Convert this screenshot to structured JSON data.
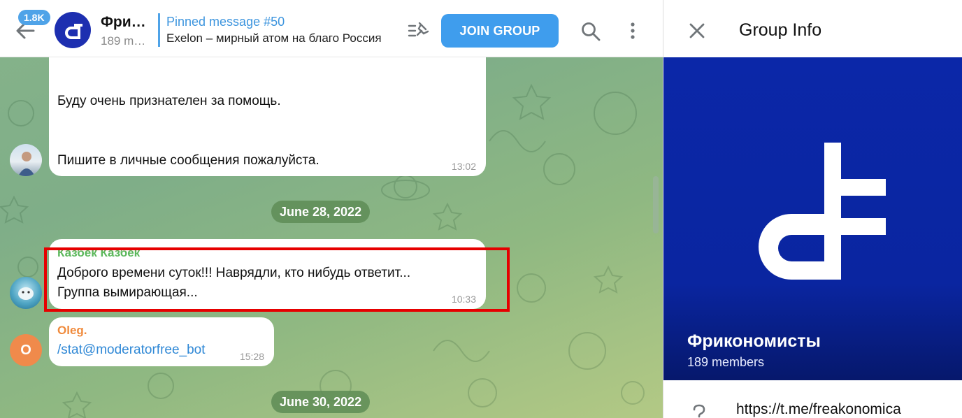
{
  "header": {
    "unread_count": "1.8K",
    "chat_title": "Фрикономисты",
    "chat_subtitle": "189 members",
    "pinned_title": "Pinned message #50",
    "pinned_text": "Exelon – мирный атом на благо Россия",
    "join_label": "JOIN GROUP"
  },
  "messages": [
    {
      "lines": [
        "Буду очень признателен за помощь.",
        "Пишите в личные сообщения пожалуйста."
      ],
      "time": "13:02"
    },
    {
      "sender": "Казбек Казбек",
      "lines": [
        "Доброго времени суток!!! Наврядли, кто нибудь ответит...",
        "Группа вымирающая..."
      ],
      "time": "10:33"
    },
    {
      "sender": "Oleg.",
      "avatar_letter": "O",
      "lines": [
        "/stat@moderatorfree_bot"
      ],
      "time": "15:28"
    }
  ],
  "dates": [
    "June 28, 2022",
    "June 30, 2022"
  ],
  "info_panel": {
    "title": "Group Info",
    "group_name": "Фрикономисты",
    "members": "189 members",
    "link": "https://t.me/freakonomica"
  },
  "colors": {
    "accent": "#3f9ded",
    "cover_blue": "#0b27a8",
    "highlight": "#e60000",
    "sender_green": "#5cb85c",
    "sender_orange": "#f08a3c",
    "link_blue": "#2f88d6"
  },
  "icons": [
    "arrow-left-icon",
    "pin-list-icon",
    "search-icon",
    "more-vertical-icon",
    "close-icon",
    "link-icon"
  ]
}
